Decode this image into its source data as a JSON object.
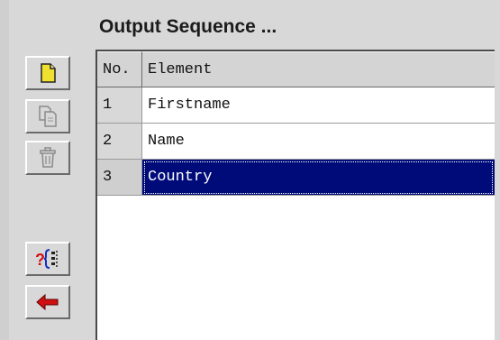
{
  "panel": {
    "title": "Output Sequence ..."
  },
  "toolbar": {
    "buttons": [
      {
        "name": "new-item",
        "icon": "new-document-icon",
        "enabled": true
      },
      {
        "name": "copy-item",
        "icon": "copy-document-icon",
        "enabled": false
      },
      {
        "name": "delete-item",
        "icon": "trash-icon",
        "enabled": false
      },
      {
        "name": "insert-condition",
        "icon": "question-brace-icon",
        "enabled": true
      },
      {
        "name": "move-back",
        "icon": "red-left-arrow-icon",
        "enabled": true
      }
    ]
  },
  "table": {
    "columns": {
      "no": "No.",
      "element": "Element"
    },
    "rows": [
      {
        "no": "1",
        "element": "Firstname",
        "selected": false
      },
      {
        "no": "2",
        "element": "Name",
        "selected": false
      },
      {
        "no": "3",
        "element": "Country",
        "selected": true
      }
    ]
  },
  "colors": {
    "selection": "#000b7a",
    "arrow": "#d01010",
    "icon_yellow": "#f0e030"
  }
}
